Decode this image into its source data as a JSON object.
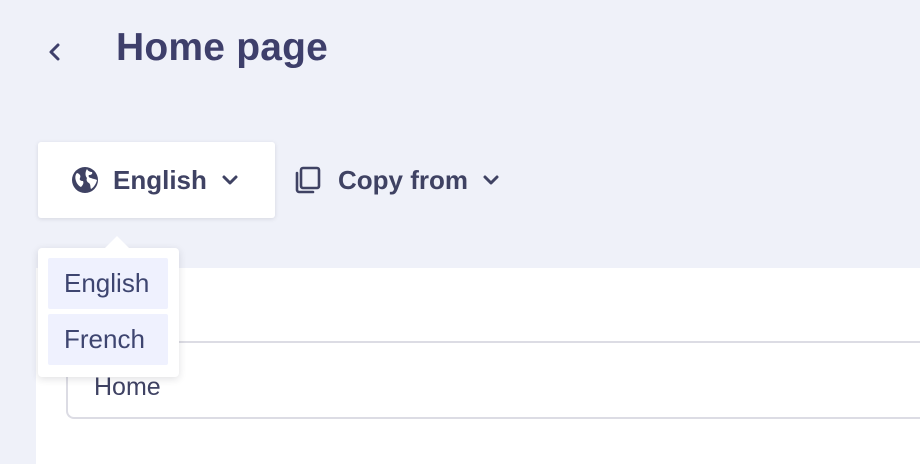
{
  "header": {
    "back_icon": "chevron-left-icon",
    "title": "Home page"
  },
  "toolbar": {
    "language": {
      "icon": "globe-icon",
      "label": "English",
      "chevron_icon": "chevron-down-icon",
      "expanded": true
    },
    "copy_from": {
      "icon": "copy-icon",
      "label": "Copy from",
      "chevron_icon": "chevron-down-icon"
    }
  },
  "language_menu": {
    "options": [
      {
        "label": "English"
      },
      {
        "label": "French"
      }
    ]
  },
  "form": {
    "name_field": {
      "value": "Home"
    }
  },
  "colors": {
    "background": "#eff1f9",
    "text": "#3f4263",
    "title": "#3e3f6b",
    "option_highlight": "#eff1fe",
    "input_border": "#dcdce4"
  }
}
